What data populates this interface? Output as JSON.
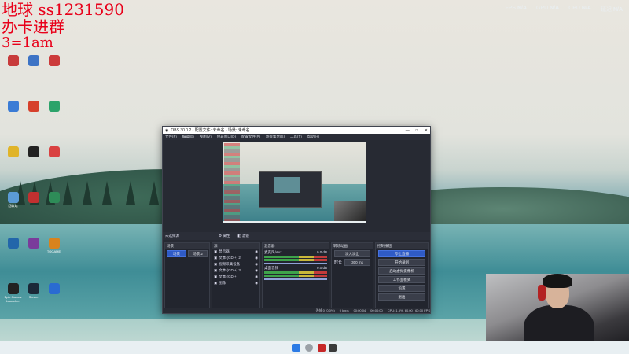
{
  "overlay": {
    "line1": "地球 ss1231590",
    "line2": "办卡进群",
    "line3": "3=1am"
  },
  "system_stats": {
    "fps_label": "FPS",
    "fps_value": "N/A",
    "gpu_label": "GPU",
    "gpu_value": "N/A",
    "cpu_label": "CPU",
    "cpu_value": "N/A",
    "latency_label": "延迟",
    "latency_value": "N/A"
  },
  "desktop_icons": [
    {
      "label": "",
      "color": "#c83b3b"
    },
    {
      "label": "",
      "color": "#3d73c5"
    },
    {
      "label": "",
      "color": "#cc3a3a"
    },
    {
      "label": "",
      "color": "#3a7bd5"
    },
    {
      "label": "",
      "color": "#d6402b"
    },
    {
      "label": "",
      "color": "#2ca36a"
    },
    {
      "label": "",
      "color": "#e0b429"
    },
    {
      "label": "",
      "color": "#222222"
    },
    {
      "label": "",
      "color": "#d94141"
    },
    {
      "label": "回收站",
      "color": "#5b9bd5"
    },
    {
      "label": "",
      "color": "#c13030"
    },
    {
      "label": "",
      "color": "#2e8c58"
    },
    {
      "label": "",
      "color": "#2266aa"
    },
    {
      "label": "",
      "color": "#7a3b9b"
    },
    {
      "label": "TOGAME",
      "color": "#d8831d"
    },
    {
      "label": "Epic Games Launcher",
      "color": "#222222"
    },
    {
      "label": "Steam",
      "color": "#1b2838"
    },
    {
      "label": "",
      "color": "#2a6bd1"
    }
  ],
  "obs": {
    "title": "OBS 30.0.2 - 配置文件: 未命名 - 场景: 未命名",
    "menus": [
      "文件(F)",
      "编辑(E)",
      "视图(V)",
      "停靠窗口(D)",
      "配置文件(P)",
      "场景集合(S)",
      "工具(T)",
      "帮助(H)"
    ],
    "scene_label": "未选择源",
    "properties_label": "属性",
    "filters_label": "滤镜",
    "docks": {
      "scenes": {
        "title": "场景",
        "items": [
          "场景",
          "场景 2"
        ]
      },
      "sources": {
        "title": "源",
        "items": [
          "显示器",
          "文本 (GDI+) 2",
          "视频采集设备",
          "文本 (GDI+) 3",
          "文本 (GDI+)",
          "图像"
        ]
      },
      "mixer": {
        "title": "混音器",
        "items": [
          {
            "name": "麦克风/Aux",
            "db": "0.0 dB"
          },
          {
            "name": "桌面音频",
            "db": "0.0 dB"
          }
        ]
      },
      "transitions": {
        "title": "转场动画",
        "type": "淡入淡出",
        "duration_label": "时长",
        "duration": "300 ms"
      },
      "controls": {
        "title": "控制按钮",
        "buttons": [
          "停止直播",
          "开始录制",
          "启动虚拟摄像机",
          "工作室模式",
          "设置",
          "退出"
        ]
      }
    },
    "status": {
      "dropped": "丢帧 0 (0.0%)",
      "net": "0 kbps",
      "live": "00:00:04",
      "rec": "00:00:00",
      "cpu": "CPU: 1.5%, 60.00 / 60.00 FPS"
    }
  },
  "colors": {
    "accent": "#2f5bc6",
    "overlay_red": "#e8001a"
  }
}
